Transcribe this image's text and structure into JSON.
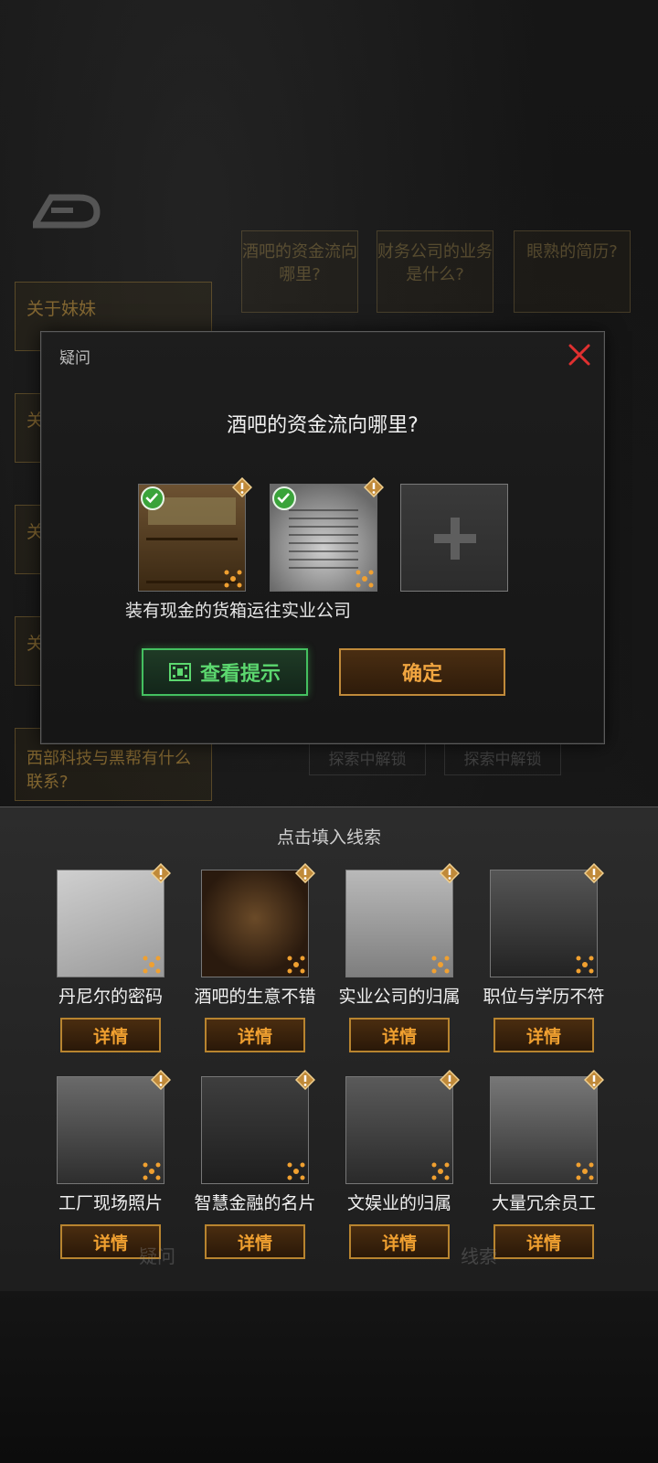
{
  "background": {
    "questions": [
      "酒吧的资金流向哪里?",
      "财务公司的业务是什么?",
      "眼熟的简历?"
    ],
    "side_items": [
      "关于妹妹",
      "关",
      "关",
      "关",
      "西部科技与黑帮有什么联系?"
    ],
    "locked": [
      "探索中解锁",
      "探索中解锁"
    ],
    "tabs": [
      "疑问",
      "线索"
    ]
  },
  "dialog": {
    "title": "疑问",
    "question": "酒吧的资金流向哪里?",
    "caption": "装有现金的货箱运往实业公司",
    "hint_button": "查看提示",
    "confirm_button": "确定"
  },
  "panel": {
    "title": "点击填入线索",
    "detail_label": "详情",
    "clues": [
      {
        "name": "丹尼尔的密码"
      },
      {
        "name": "酒吧的生意不错"
      },
      {
        "name": "实业公司的归属"
      },
      {
        "name": "职位与学历不符"
      },
      {
        "name": "工厂现场照片"
      },
      {
        "name": "智慧金融的名片"
      },
      {
        "name": "文娱业的归属"
      },
      {
        "name": "大量冗余员工"
      }
    ]
  },
  "colors": {
    "accent_green": "#44c060",
    "accent_orange": "#f0a030",
    "close_red": "#e03030"
  }
}
